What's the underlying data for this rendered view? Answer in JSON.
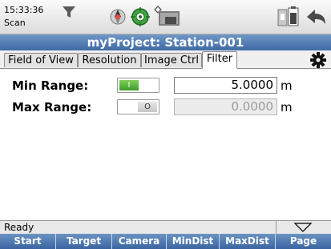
{
  "status_bar": {
    "time": "15:33:36",
    "mode": "Scan",
    "icons": [
      "filter-icon",
      "prism-target-icon",
      "level-bubble-icon",
      "wifi-signal-icon",
      "camera-view-icon",
      "battery-memory-icon",
      "back-arrow-icon"
    ]
  },
  "title": "myProject: Station-001",
  "tabs": [
    {
      "label": "Field of View"
    },
    {
      "label": "Resolution"
    },
    {
      "label": "Image Ctrl"
    },
    {
      "label": "Filter",
      "active": true
    }
  ],
  "settings_icon": "gear-icon",
  "filter": {
    "min_range": {
      "label": "Min Range:",
      "toggle_symbol": "I",
      "enabled": true,
      "value": "5.0000",
      "unit": "m"
    },
    "max_range": {
      "label": "Max Range:",
      "toggle_symbol": "O",
      "enabled": false,
      "value": "0.0000",
      "unit": "m"
    }
  },
  "status_line": {
    "text": "Ready",
    "menu_icon": "triangle-down-icon"
  },
  "softkeys": [
    {
      "label": "Start"
    },
    {
      "label": "Target"
    },
    {
      "label": "Camera"
    },
    {
      "label": "MinDist"
    },
    {
      "label": "MaxDist"
    },
    {
      "label": "Page"
    }
  ],
  "colors": {
    "title_bar": "#4a76ad",
    "toggle_on": "#4caf33",
    "softkey_bar": "#3f6aa4"
  }
}
